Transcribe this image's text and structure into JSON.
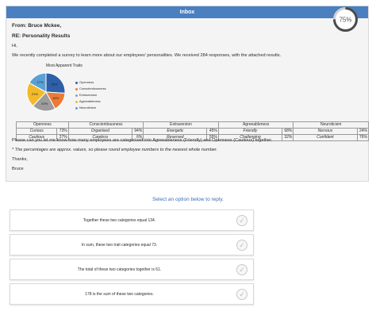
{
  "email": {
    "header_title": "Inbox",
    "timer_percent": "75%",
    "timer_fraction": 0.75,
    "from": "From: Bruce Mckee,",
    "subject": "RE: Personality Results",
    "greeting": "Hi,",
    "intro": "We recently completed a survey to learn more about our employees' personalities. We received 284 responses, with the attached results.",
    "question": "Please can you let me know how many employees are categorised into Agreeableness (Friendly) and Openness (Cautious) together.",
    "note": "* The percentages are approx. values, so please round employee numbers to the nearest whole number.",
    "thanks": "Thanks,",
    "signature": "Bruce"
  },
  "chart_data": {
    "type": "pie",
    "title": "Most Apparent Traits",
    "labels": [
      "Openness",
      "Conscientiousness",
      "Extraversion",
      "Agreeableness",
      "Neuroticism"
    ],
    "values": [
      26,
      16,
      20,
      21,
      17
    ],
    "value_labels": [
      "26%",
      "16%",
      "20%",
      "21%",
      "17%"
    ],
    "colors": [
      "#2e5fa8",
      "#ec7a34",
      "#9c9c9c",
      "#f2b92a",
      "#5aa0d4"
    ]
  },
  "traits_table": {
    "headers": [
      "Openness",
      "Conscientiousness",
      "Extraversion",
      "Agreeableness",
      "Neuroticism"
    ],
    "rows": [
      [
        [
          "Curious",
          "73%"
        ],
        [
          "Organised",
          "94%"
        ],
        [
          "Energetic",
          "45%"
        ],
        [
          "Friendly",
          "68%"
        ],
        [
          "Nervous",
          "24%"
        ]
      ],
      [
        [
          "Cautious",
          "27%"
        ],
        [
          "Careless",
          "6%"
        ],
        [
          "Reserved",
          "55%"
        ],
        [
          "Challenging",
          "32%"
        ],
        [
          "Confident",
          "76%"
        ]
      ]
    ]
  },
  "reply": {
    "prompt": "Select an option below to reply.",
    "options": [
      "Together these two categories equal 134.",
      "In sum, these two trait categories equal 73.",
      "The total of these two categories together is 61.",
      "178 is the sum of these two categories."
    ],
    "check_glyph": "✓"
  }
}
